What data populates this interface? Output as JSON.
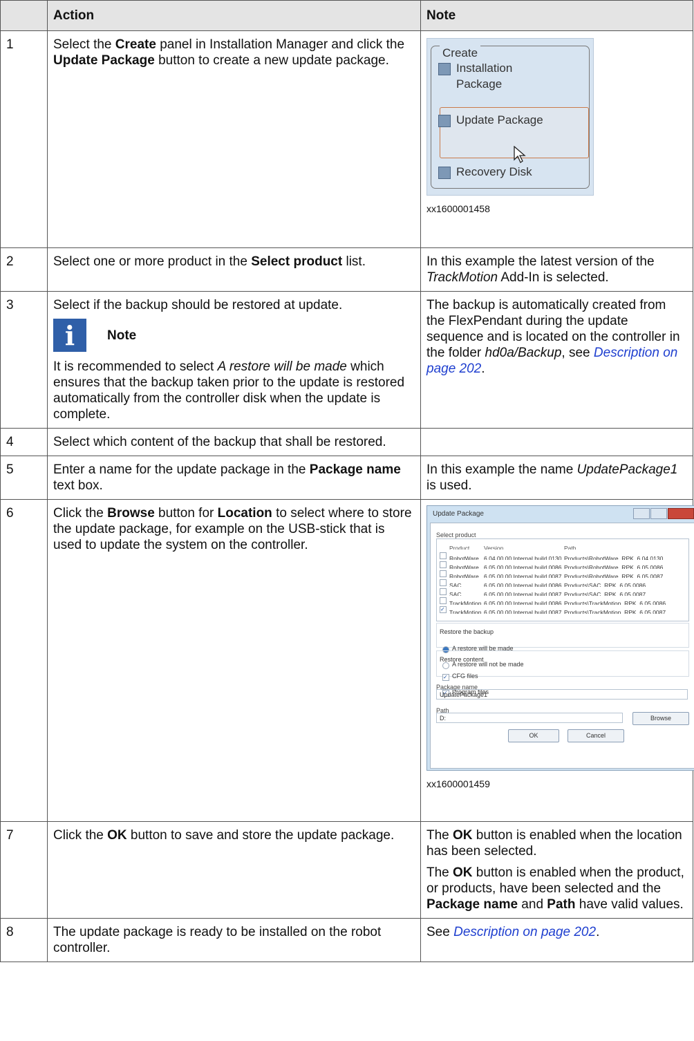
{
  "header": {
    "num": "",
    "action": "Action",
    "note": "Note"
  },
  "rows": [
    {
      "num": "1",
      "a": [
        "Select the ",
        "Create",
        " panel in Installation Manager and click the ",
        "Update Package",
        " button to create a new update package."
      ],
      "caption": "xx1600001458"
    },
    {
      "num": "2",
      "a": [
        "Select one or more product in the ",
        "Select product",
        " list."
      ],
      "n": [
        "In this example the latest version of the ",
        "TrackMotion",
        " Add-In is selected."
      ]
    },
    {
      "num": "3",
      "a": "Select if the backup should be restored at update.",
      "note_title": "Note",
      "a2": [
        "It is recommended to select ",
        "A restore will be made",
        " which ensures that the backup taken prior to the update is restored automatically from the controller disk when the update is complete."
      ],
      "n": [
        "The backup is automatically created from the FlexPendant during the update sequence and is located on the controller in the folder ",
        "hd0a/Backup",
        ", see ",
        "Description on page 202",
        "."
      ]
    },
    {
      "num": "4",
      "a": "Select which content of the backup that shall be restored."
    },
    {
      "num": "5",
      "a": [
        "Enter a name for the update package in the ",
        "Package name",
        " text box."
      ],
      "n": [
        "In this example the name ",
        "UpdatePackage1",
        " is used."
      ]
    },
    {
      "num": "6",
      "a": [
        "Click the ",
        "Browse",
        " button for ",
        "Location",
        " to select where to store the update package, for example on the USB-stick that is used to update the system on the controller."
      ],
      "caption": "xx1600001459"
    },
    {
      "num": "7",
      "a": [
        "Click the ",
        "OK",
        " button to save and store the update package."
      ],
      "n1": [
        "The ",
        "OK",
        " button is enabled when the location has been selected."
      ],
      "n2": [
        "The ",
        "OK",
        " button is enabled when the product, or products, have been selected and the ",
        "Package name",
        " and ",
        "Path",
        " have valid values."
      ]
    },
    {
      "num": "8",
      "a": "The update package is ready to be installed on the robot controller.",
      "n": [
        "See ",
        "Description on page 202",
        "."
      ]
    }
  ],
  "create_panel": {
    "legend": "Create",
    "items": [
      "Installation Package",
      "Update Package",
      "Recovery Disk"
    ]
  },
  "dialog": {
    "title": "Update Package",
    "select_product_label": "Select product",
    "columns": [
      "Product",
      "Version",
      "Path"
    ],
    "products": [
      {
        "product": "RobotWare",
        "version": "6.04.00.00 Internal build 0130",
        "path": "Products\\RobotWare_RPK_6.04.0130",
        "checked": false
      },
      {
        "product": "RobotWare",
        "version": "6.05.00.00 Internal build 0086",
        "path": "Products\\RobotWare_RPK_6.05.0086",
        "checked": false
      },
      {
        "product": "RobotWare",
        "version": "6.05.00.00 Internal build 0087",
        "path": "Products\\RobotWare_RPK_6.05.0087",
        "checked": false
      },
      {
        "product": "SAC",
        "version": "6.05.00.00 Internal build 0086",
        "path": "Products\\SAC_RPK_6.05.0086",
        "checked": false
      },
      {
        "product": "SAC",
        "version": "6.05.00.00 Internal build 0087",
        "path": "Products\\SAC_RPK_6.05.0087",
        "checked": false
      },
      {
        "product": "TrackMotion",
        "version": "6.05.00.00 Internal build 0086",
        "path": "Products\\TrackMotion_RPK_6.05.0086",
        "checked": false
      },
      {
        "product": "TrackMotion",
        "version": "6.05.00.00 Internal build 0087",
        "path": "Products\\TrackMotion_RPK_6.05.0087",
        "checked": true
      }
    ],
    "restore_label": "Restore the backup",
    "restore_options": [
      "A restore will be made",
      "A restore will not be made"
    ],
    "content_label": "Restore content",
    "content_options": [
      "CFG files",
      "Program files"
    ],
    "package_name_label": "Package name",
    "package_name_value": "UpdatePackage1",
    "path_label": "Path",
    "path_value": "D:",
    "browse": "Browse",
    "ok": "OK",
    "cancel": "Cancel"
  },
  "colors": {
    "header_bg": "#e4e4e4",
    "link": "#1f3fcf",
    "note_icon": "#2f5fa8"
  }
}
